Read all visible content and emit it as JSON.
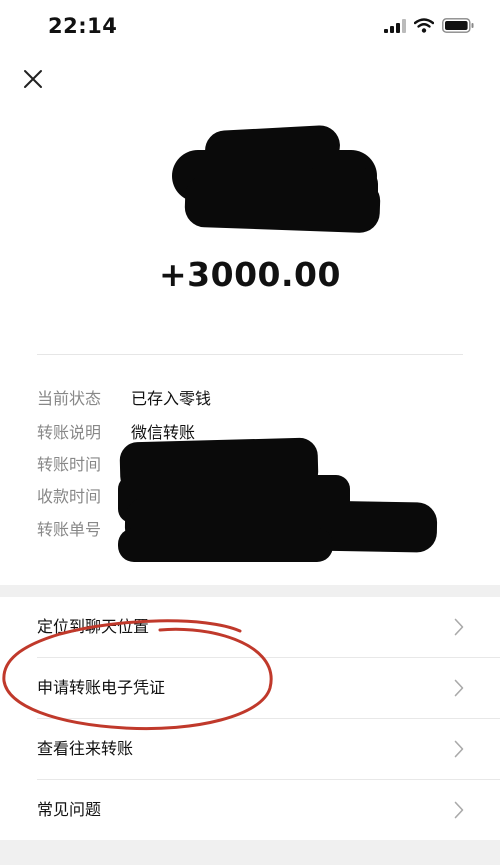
{
  "status_bar": {
    "time": "22:14"
  },
  "transfer": {
    "amount": "+3000.00"
  },
  "details": [
    {
      "label": "当前状态",
      "value": "已存入零钱"
    },
    {
      "label": "转账说明",
      "value": "微信转账"
    },
    {
      "label": "转账时间",
      "value": ""
    },
    {
      "label": "收款时间",
      "value": ""
    },
    {
      "label": "转账单号",
      "value": ""
    }
  ],
  "menu": [
    {
      "label": "定位到聊天位置"
    },
    {
      "label": "申请转账电子凭证"
    },
    {
      "label": "查看往来转账"
    },
    {
      "label": "常见问题"
    }
  ],
  "colors": {
    "annotation": "#c0392b",
    "label_gray": "#888888",
    "background_band": "#f0f0f0"
  }
}
